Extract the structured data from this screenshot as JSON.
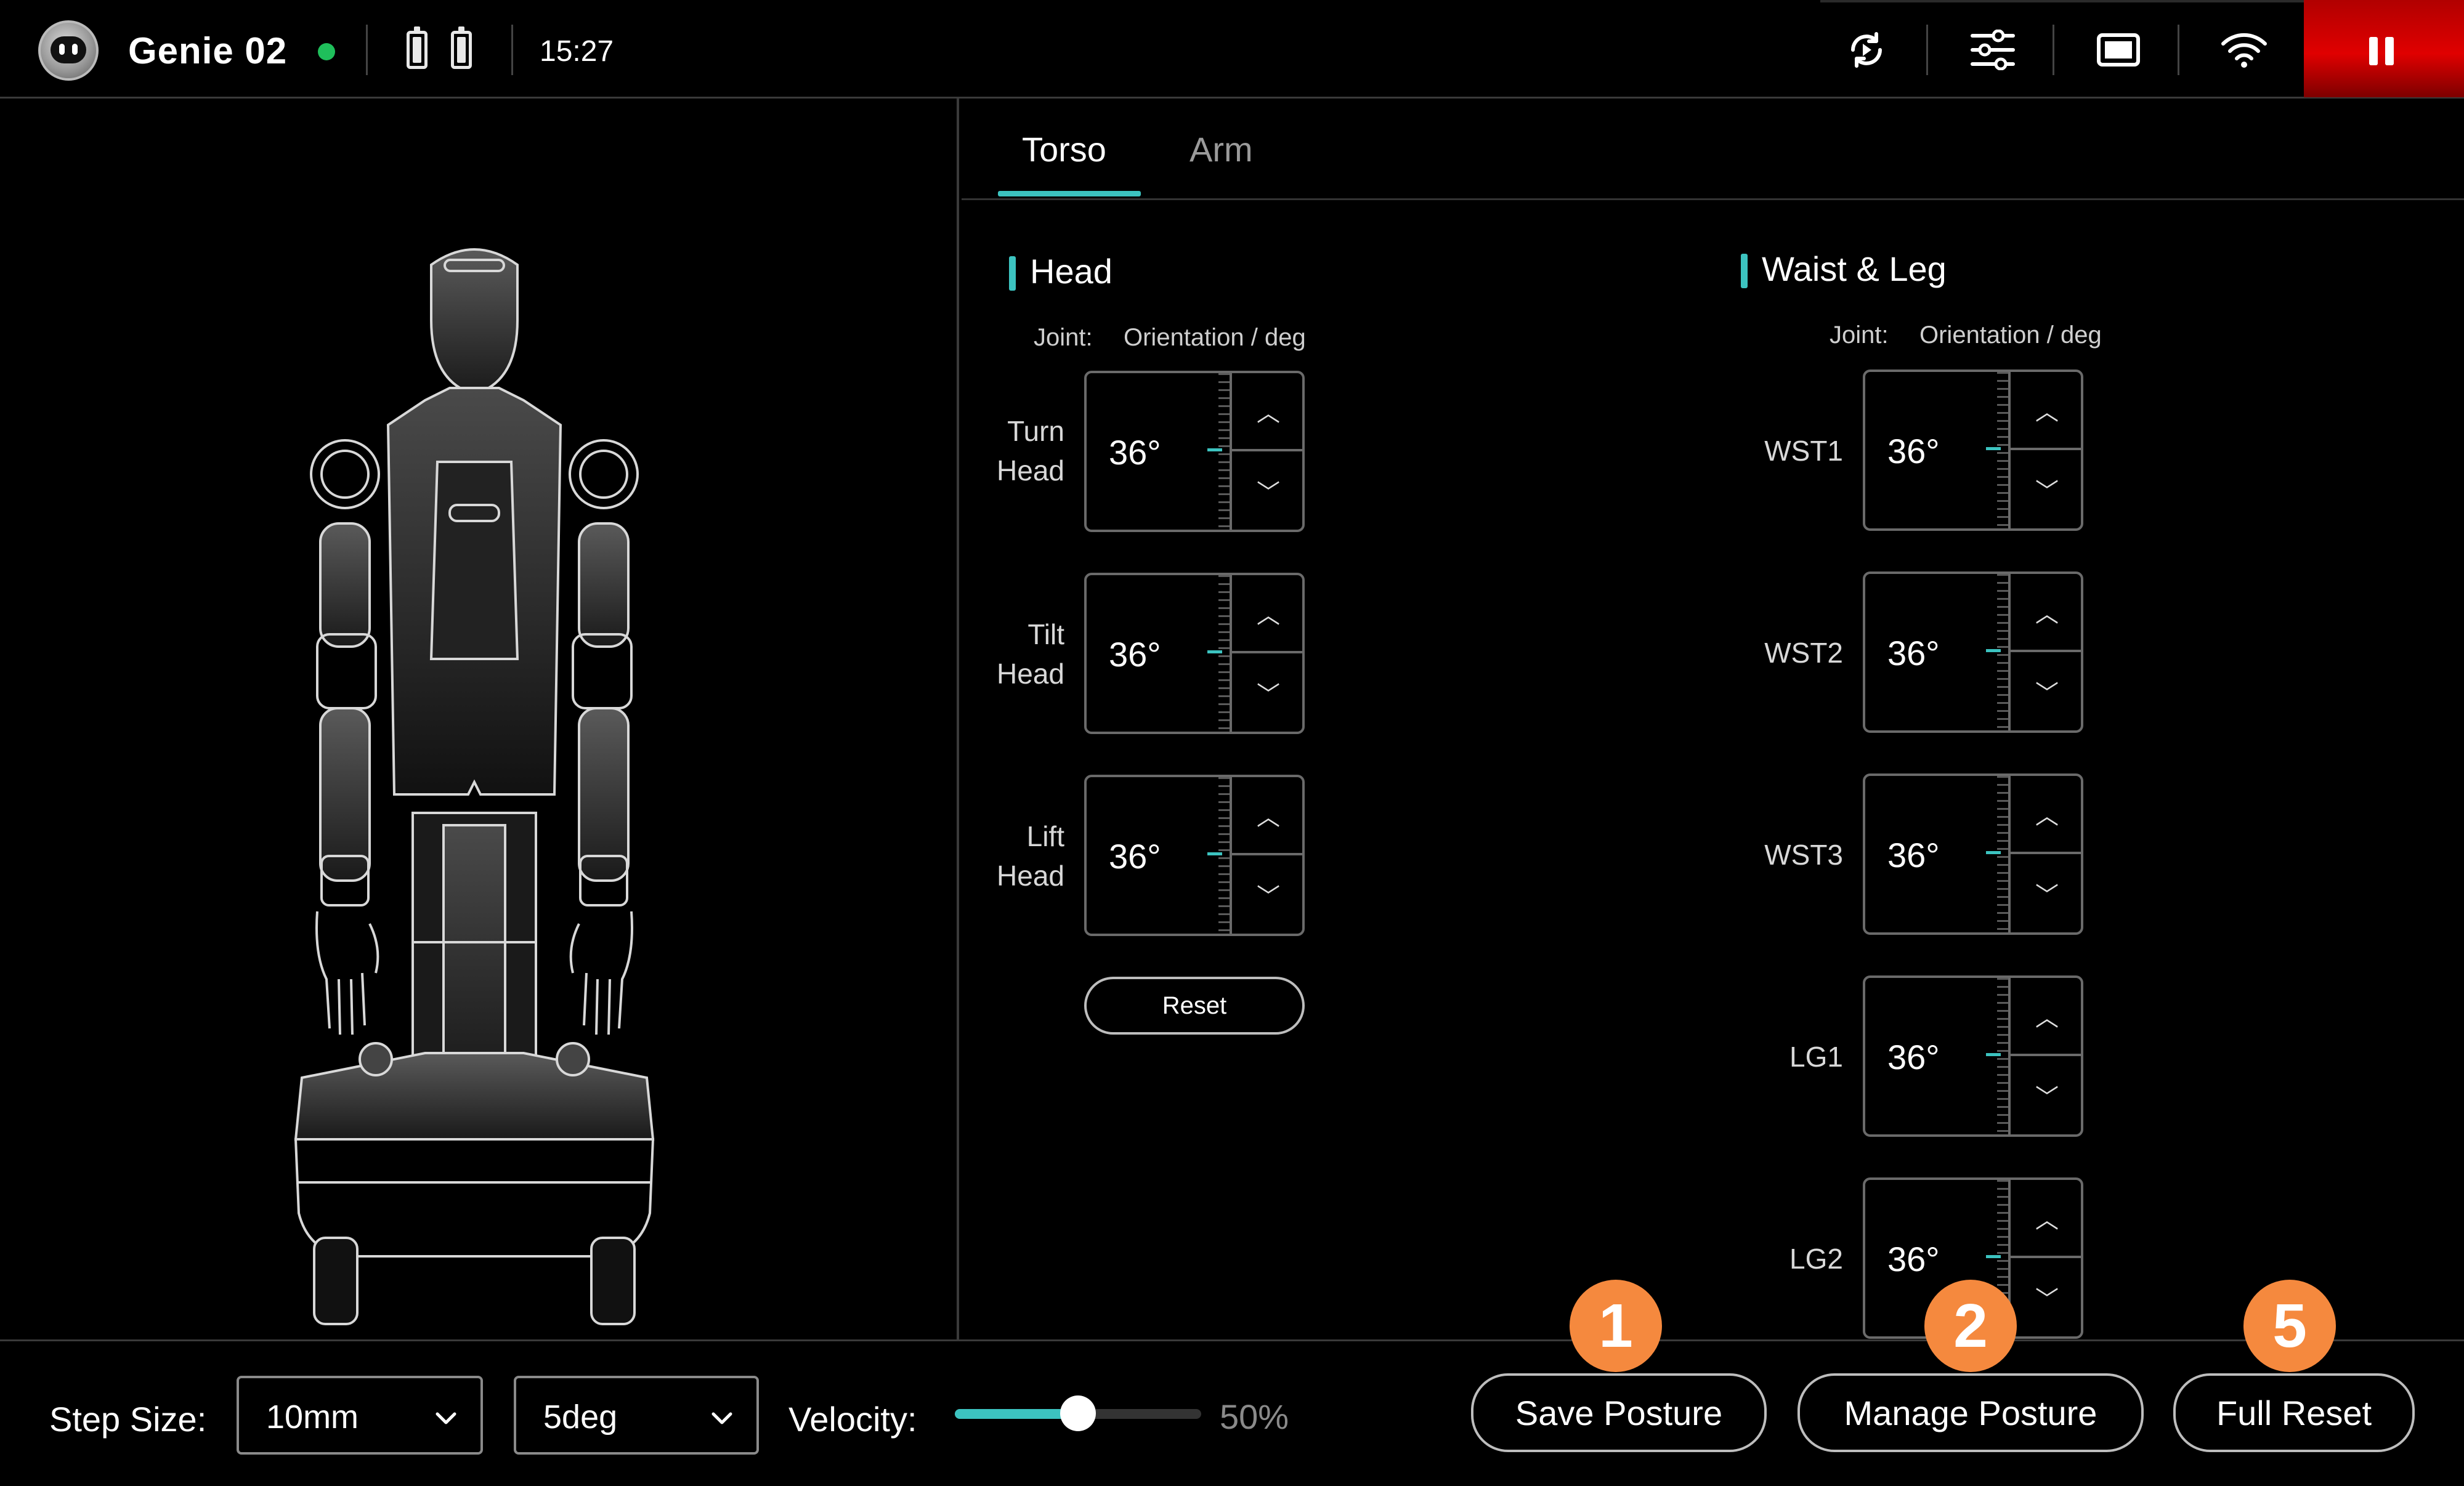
{
  "header": {
    "robot_name": "Genie 02",
    "time": "15:27",
    "status_color": "#1fbf5b",
    "icons": [
      "robot-face-icon",
      "battery-icon",
      "battery-icon",
      "refresh-play-icon",
      "sliders-icon",
      "screen-icon",
      "wifi-icon",
      "pause-icon"
    ]
  },
  "tabs": [
    {
      "label": "Torso",
      "active": true
    },
    {
      "label": "Arm",
      "active": false
    }
  ],
  "head_section": {
    "title": "Head",
    "col_joint": "Joint:",
    "col_orient": "Orientation / deg",
    "joints": [
      {
        "label_line1": "Turn",
        "label_line2": "Head",
        "value": "36°"
      },
      {
        "label_line1": "Tilt",
        "label_line2": "Head",
        "value": "36°"
      },
      {
        "label_line1": "Lift",
        "label_line2": "Head",
        "value": "36°"
      }
    ],
    "reset_label": "Reset"
  },
  "waist_section": {
    "title": "Waist & Leg",
    "col_joint": "Joint:",
    "col_orient": "Orientation / deg",
    "joints": [
      {
        "label": "WST1",
        "value": "36°"
      },
      {
        "label": "WST2",
        "value": "36°"
      },
      {
        "label": "WST3",
        "value": "36°"
      },
      {
        "label": "LG1",
        "value": "36°"
      },
      {
        "label": "LG2",
        "value": "36°"
      }
    ]
  },
  "bottom": {
    "step_size_label": "Step Size:",
    "step_mm": "10mm",
    "step_deg": "5deg",
    "velocity_label": "Velocity:",
    "velocity_value": 0.5,
    "velocity_text": "50%",
    "save_posture": "Save Posture",
    "manage_posture": "Manage Posture",
    "full_reset": "Full Reset"
  },
  "badges": [
    "1",
    "2",
    "5"
  ],
  "colors": {
    "accent": "#3cc3c0",
    "badge": "#f5893e",
    "stop": "#e00000"
  }
}
